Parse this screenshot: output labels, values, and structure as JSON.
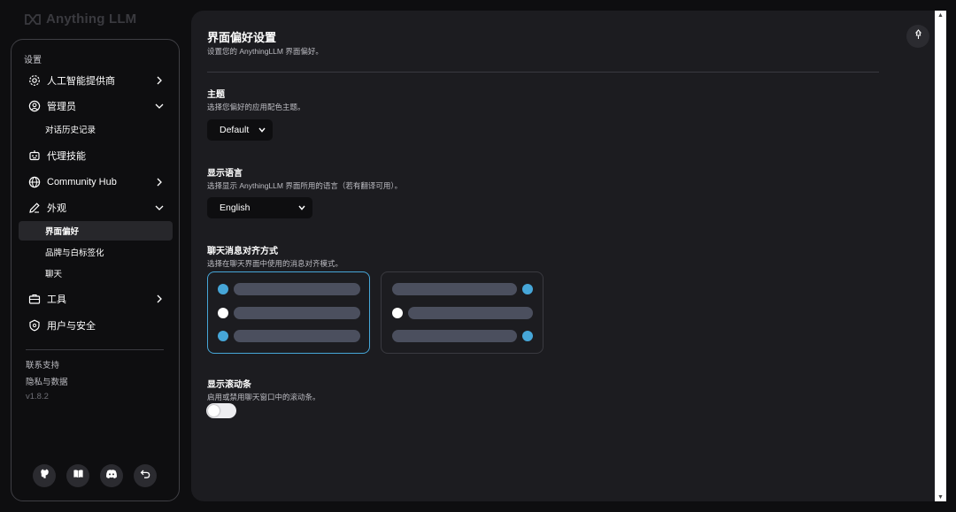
{
  "brand": {
    "name": "Anything LLM"
  },
  "sidebar": {
    "section_title": "设置",
    "items": [
      {
        "label": "人工智能提供商",
        "icon": "gear-icon"
      },
      {
        "label": "管理员",
        "icon": "user-gear-icon"
      },
      {
        "label": "代理技能",
        "icon": "robot-icon"
      },
      {
        "label": "Community Hub",
        "icon": "globe-icon"
      },
      {
        "label": "外观",
        "icon": "pencil-icon"
      },
      {
        "label": "工具",
        "icon": "toolbox-icon"
      },
      {
        "label": "用户与安全",
        "icon": "shield-icon"
      }
    ],
    "admin_sub": [
      "对话历史记录"
    ],
    "appearance_sub": [
      "界面偏好",
      "品牌与白标签化",
      "聊天"
    ],
    "active_sub": "界面偏好",
    "footer": {
      "support": "联系支持",
      "privacy": "隐私与数据",
      "version": "v1.8.2"
    },
    "bottom_icons": [
      "github-icon",
      "book-icon",
      "discord-icon",
      "back-arrow-icon"
    ]
  },
  "main": {
    "title": "界面偏好设置",
    "subtitle": "设置您的 AnythingLLM 界面偏好。",
    "theme": {
      "title": "主题",
      "desc": "选择您偏好的应用配色主题。",
      "value": "Default"
    },
    "language": {
      "title": "显示语言",
      "desc": "选择显示 AnythingLLM 界面所用的语言（若有翻译可用）。",
      "value": "English"
    },
    "alignment": {
      "title": "聊天消息对齐方式",
      "desc": "选择在聊天界面中使用的消息对齐模式。",
      "selected": "left"
    },
    "scrollbar": {
      "title": "显示滚动条",
      "desc": "启用或禁用聊天窗口中的滚动条。",
      "enabled": false
    }
  },
  "colors": {
    "accent": "#46a6d8",
    "bubble": "#4b4f5e",
    "panel": "#1c1c20",
    "background": "#0e0e10"
  }
}
